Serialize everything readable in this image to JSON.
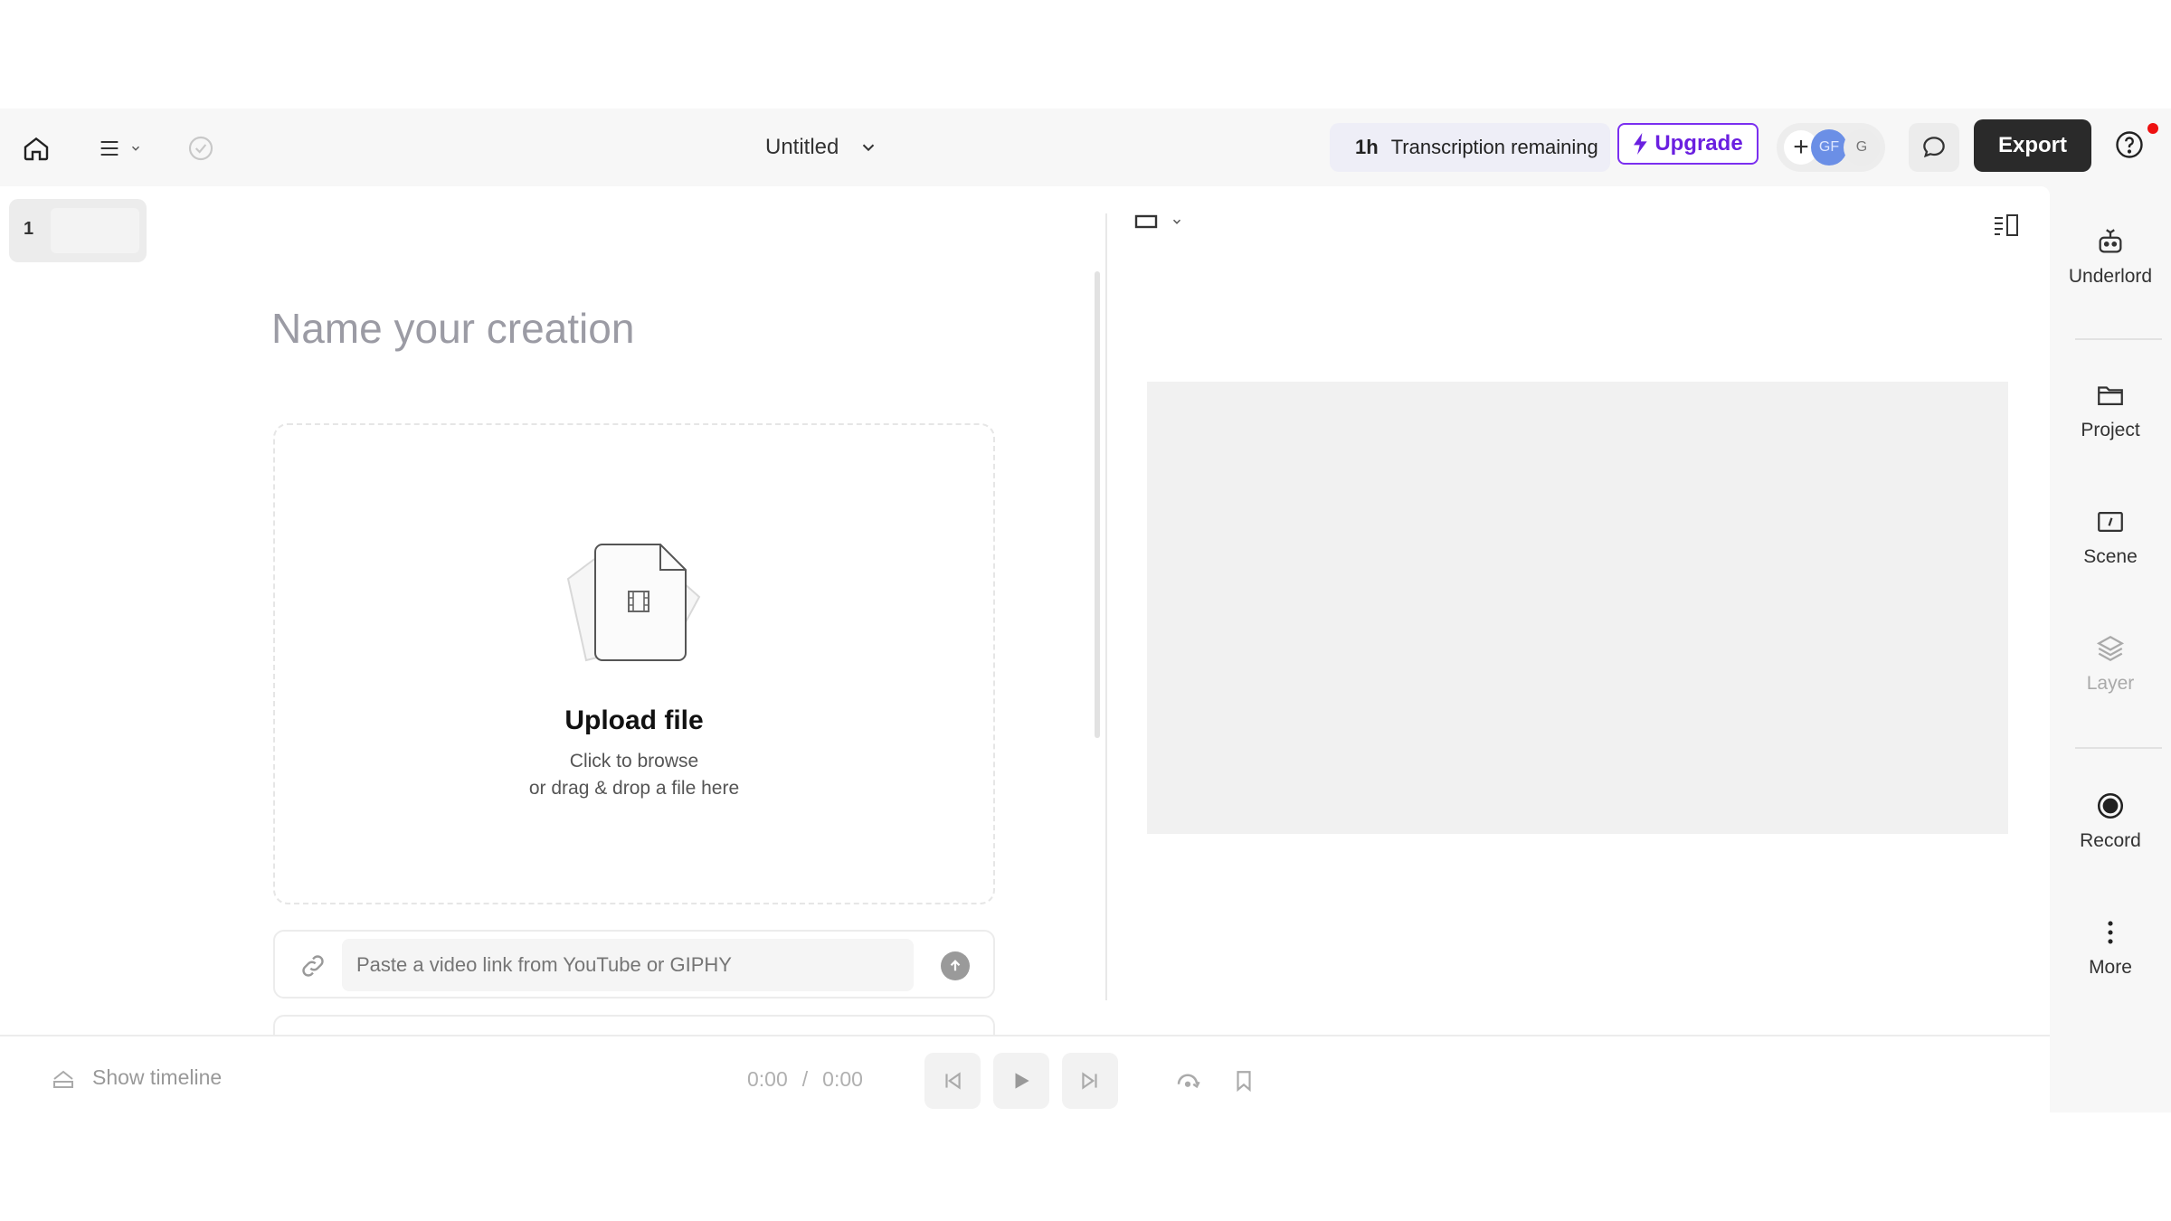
{
  "topbar": {
    "project_title": "Untitled",
    "transcription_hours": "1h",
    "transcription_label": "Transcription remaining",
    "upgrade_label": "Upgrade",
    "avatar_1": "GF",
    "avatar_2": "G",
    "export_label": "Export"
  },
  "pages": {
    "current": "1"
  },
  "editor": {
    "name_placeholder": "Name your creation",
    "upload_title": "Upload file",
    "upload_line1": "Click to browse",
    "upload_line2": "or drag & drop a file here",
    "link_placeholder": "Paste a video link from YouTube or GIPHY"
  },
  "playback": {
    "show_timeline_label": "Show timeline",
    "current_time": "0:00",
    "separator": "/",
    "total_time": "0:00"
  },
  "rail": {
    "items": [
      {
        "label": "Underlord",
        "icon": "robot-icon"
      },
      {
        "label": "Project",
        "icon": "folder-icon"
      },
      {
        "label": "Scene",
        "icon": "scene-icon"
      },
      {
        "label": "Layer",
        "icon": "layers-icon"
      },
      {
        "label": "Record",
        "icon": "record-icon"
      },
      {
        "label": "More",
        "icon": "more-vertical-icon"
      }
    ]
  },
  "colors": {
    "accent": "#7b2ff0",
    "export_bg": "#2a2a2a",
    "avatar": "#6b8fe6",
    "notification": "#e11111"
  }
}
